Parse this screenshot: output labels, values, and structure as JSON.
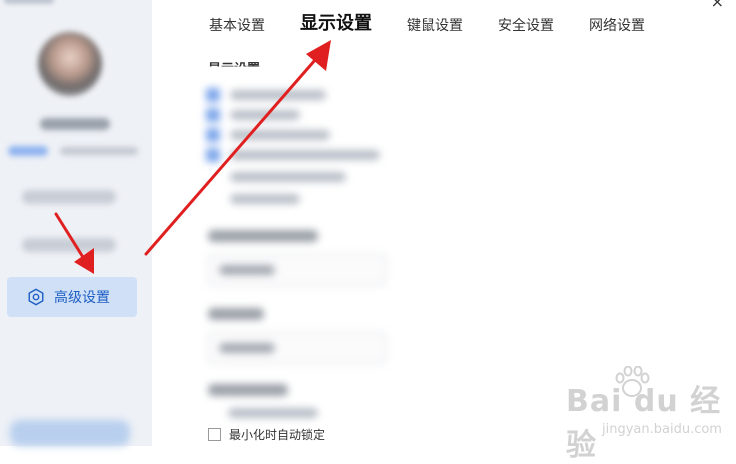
{
  "window": {
    "close_glyph": "×"
  },
  "sidebar": {
    "active_item": {
      "label": "高级设置",
      "icon": "settings-hexagon-icon"
    }
  },
  "tabs": [
    {
      "label": "基本设置",
      "active": false
    },
    {
      "label": "显示设置",
      "active": true
    },
    {
      "label": "键鼠设置",
      "active": false
    },
    {
      "label": "安全设置",
      "active": false
    },
    {
      "label": "网络设置",
      "active": false
    }
  ],
  "main": {
    "section_title": "显示设置",
    "last_option_label": "最小化时自动锁定"
  },
  "annotation": {
    "arrow_color": "#e02020"
  },
  "watermark": {
    "brand": "Bai du 经验",
    "url": "jingyan.baidu.com"
  },
  "colors": {
    "accent": "#1f5fc4",
    "active_bg": "#cfe0f7",
    "sidebar_bg": "#eef1f6"
  }
}
